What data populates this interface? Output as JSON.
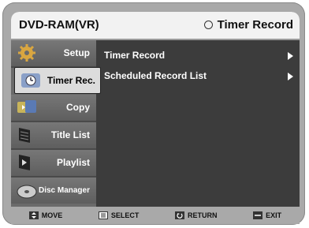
{
  "header": {
    "mode": "DVD-RAM(VR)",
    "section": "Timer Record"
  },
  "sidebar": {
    "items": [
      {
        "label": "Setup",
        "icon": "gear-icon"
      },
      {
        "label": "Timer Rec.",
        "icon": "timer-icon"
      },
      {
        "label": "Copy",
        "icon": "copy-icon"
      },
      {
        "label": "Title List",
        "icon": "title-list-icon"
      },
      {
        "label": "Playlist",
        "icon": "playlist-icon"
      },
      {
        "label": "Disc Manager",
        "icon": "disc-icon"
      }
    ]
  },
  "menu": {
    "items": [
      {
        "label": "Timer Record"
      },
      {
        "label": "Scheduled Record List"
      }
    ]
  },
  "footer": {
    "move": "MOVE",
    "select": "SELECT",
    "return": "RETURN",
    "exit": "EXIT"
  },
  "colors": {
    "screen_bg": "#3c3c3c",
    "header_bg": "#f2f2f2",
    "active_item_bg": "#dcdcdc"
  }
}
